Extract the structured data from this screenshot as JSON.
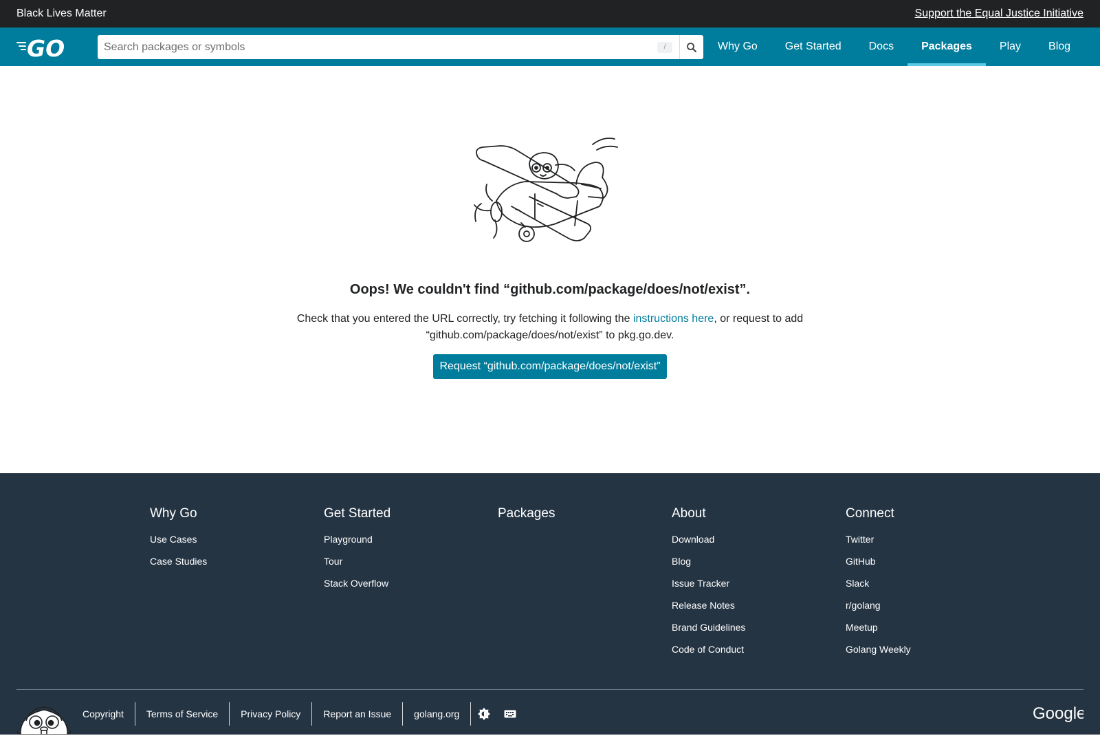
{
  "banner": {
    "left_text": "Black Lives Matter",
    "right_link": "Support the Equal Justice Initiative"
  },
  "header": {
    "logo_alt": "GO",
    "search": {
      "placeholder": "Search packages or symbols",
      "value": "",
      "shortcut": "/"
    },
    "nav": [
      {
        "label": "Why Go",
        "active": false
      },
      {
        "label": "Get Started",
        "active": false
      },
      {
        "label": "Docs",
        "active": false
      },
      {
        "label": "Packages",
        "active": true
      },
      {
        "label": "Play",
        "active": false
      },
      {
        "label": "Blog",
        "active": false
      }
    ]
  },
  "main": {
    "title": "Oops! We couldn't find “github.com/package/does/not/exist”.",
    "text_before_link": "Check that you entered the URL correctly, try fetching it following the ",
    "link_text": "instructions here",
    "text_after_link": ", or request to add “github.com/package/does/not/exist” to pkg.go.dev.",
    "request_button": "Request “github.com/package/does/not/exist”"
  },
  "footer": {
    "columns": [
      {
        "title": "Why Go",
        "links": [
          "Use Cases",
          "Case Studies"
        ]
      },
      {
        "title": "Get Started",
        "links": [
          "Playground",
          "Tour",
          "Stack Overflow"
        ]
      },
      {
        "title": "Packages",
        "links": []
      },
      {
        "title": "About",
        "links": [
          "Download",
          "Blog",
          "Issue Tracker",
          "Release Notes",
          "Brand Guidelines",
          "Code of Conduct"
        ]
      },
      {
        "title": "Connect",
        "links": [
          "Twitter",
          "GitHub",
          "Slack",
          "r/golang",
          "Meetup",
          "Golang Weekly"
        ]
      }
    ],
    "bottom_links": [
      "Copyright",
      "Terms of Service",
      "Privacy Policy",
      "Report an Issue",
      "golang.org"
    ],
    "theme_icon": "brightness-icon",
    "keyboard_icon": "keyboard-icon",
    "brand": "Google"
  },
  "colors": {
    "banner_bg": "#202224",
    "header_bg": "#007d9c",
    "active_underline": "#5dc9e2",
    "footer_bg": "#253443",
    "link": "#007d9c"
  }
}
